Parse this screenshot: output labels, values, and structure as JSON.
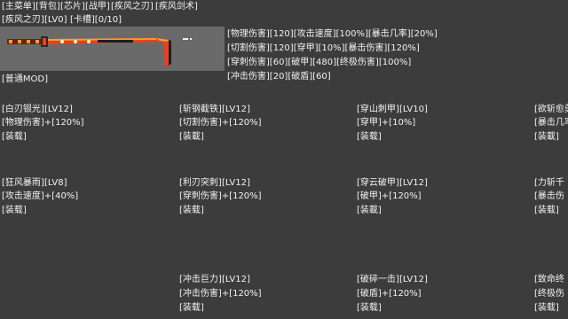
{
  "menu": [
    "[主菜单]",
    "[背包]",
    "[芯片]",
    "[战甲]",
    "[疾风之刃]",
    "[疾风剑术]"
  ],
  "weapon_header": {
    "name": "[疾风之刃]",
    "level": "[LV0]",
    "slots": "[卡槽][0/10]"
  },
  "stats": [
    "[物理伤害][120][攻击速度][100%][暴击几率][20%]",
    "[切割伤害][120][穿甲][10%][暴击伤害][120%]",
    "[穿刺伤害][60][破甲][480][终极伤害][100%]",
    "[冲击伤害][20][破盾][60]"
  ],
  "mod_type": "[普通MOD]",
  "mods": [
    {
      "name": "[白刃银光]",
      "level": "[LV12]",
      "effect": "[物理伤害]+[120%]",
      "button": "[装载]"
    },
    {
      "name": "[斩钢截铁]",
      "level": "[LV12]",
      "effect": "[切割伤害]+[120%]",
      "button": "[装載]"
    },
    {
      "name": "[穿山刺甲]",
      "level": "[LV10]",
      "effect": "[穿甲]+[10%]",
      "button": "[装载]"
    },
    {
      "name": "[欲斩愈勇",
      "level": "",
      "effect": "[暴击几率",
      "button": "[装載]"
    },
    {
      "name": "[狂风暴雨]",
      "level": "[LV8]",
      "effect": "[攻击速度]+[40%]",
      "button": "[装载]"
    },
    {
      "name": "[利刃突刺]",
      "level": "[LV12]",
      "effect": "[穿刺伤害]+[120%]",
      "button": "[装载]"
    },
    {
      "name": "[穿云破甲]",
      "level": "[LV12]",
      "effect": "[破甲]+[120%]",
      "button": "[装載]"
    },
    {
      "name": "[力斩千",
      "level": "",
      "effect": "[暴击伤",
      "button": "[装载]"
    },
    {
      "name": "[冲击巨力]",
      "level": "[LV12]",
      "effect": "[冲击伤害]+[120%]",
      "button": "[装载]"
    },
    {
      "name": "[破碎一击]",
      "level": "[LV12]",
      "effect": "[破盾]+[120%]",
      "button": "[装载]"
    },
    {
      "name": "[致命终",
      "level": "",
      "effect": "[终极伤",
      "button": "[装载]"
    }
  ],
  "colors": {
    "background": "#3c3c3c",
    "thumb_bg": "#6a6a6a",
    "text": "#f2f2f2",
    "blade_red": "#e8401c",
    "blade_orange": "#f5a02a"
  },
  "icons": {
    "weapon_thumbnail": "katana-sword-icon"
  }
}
